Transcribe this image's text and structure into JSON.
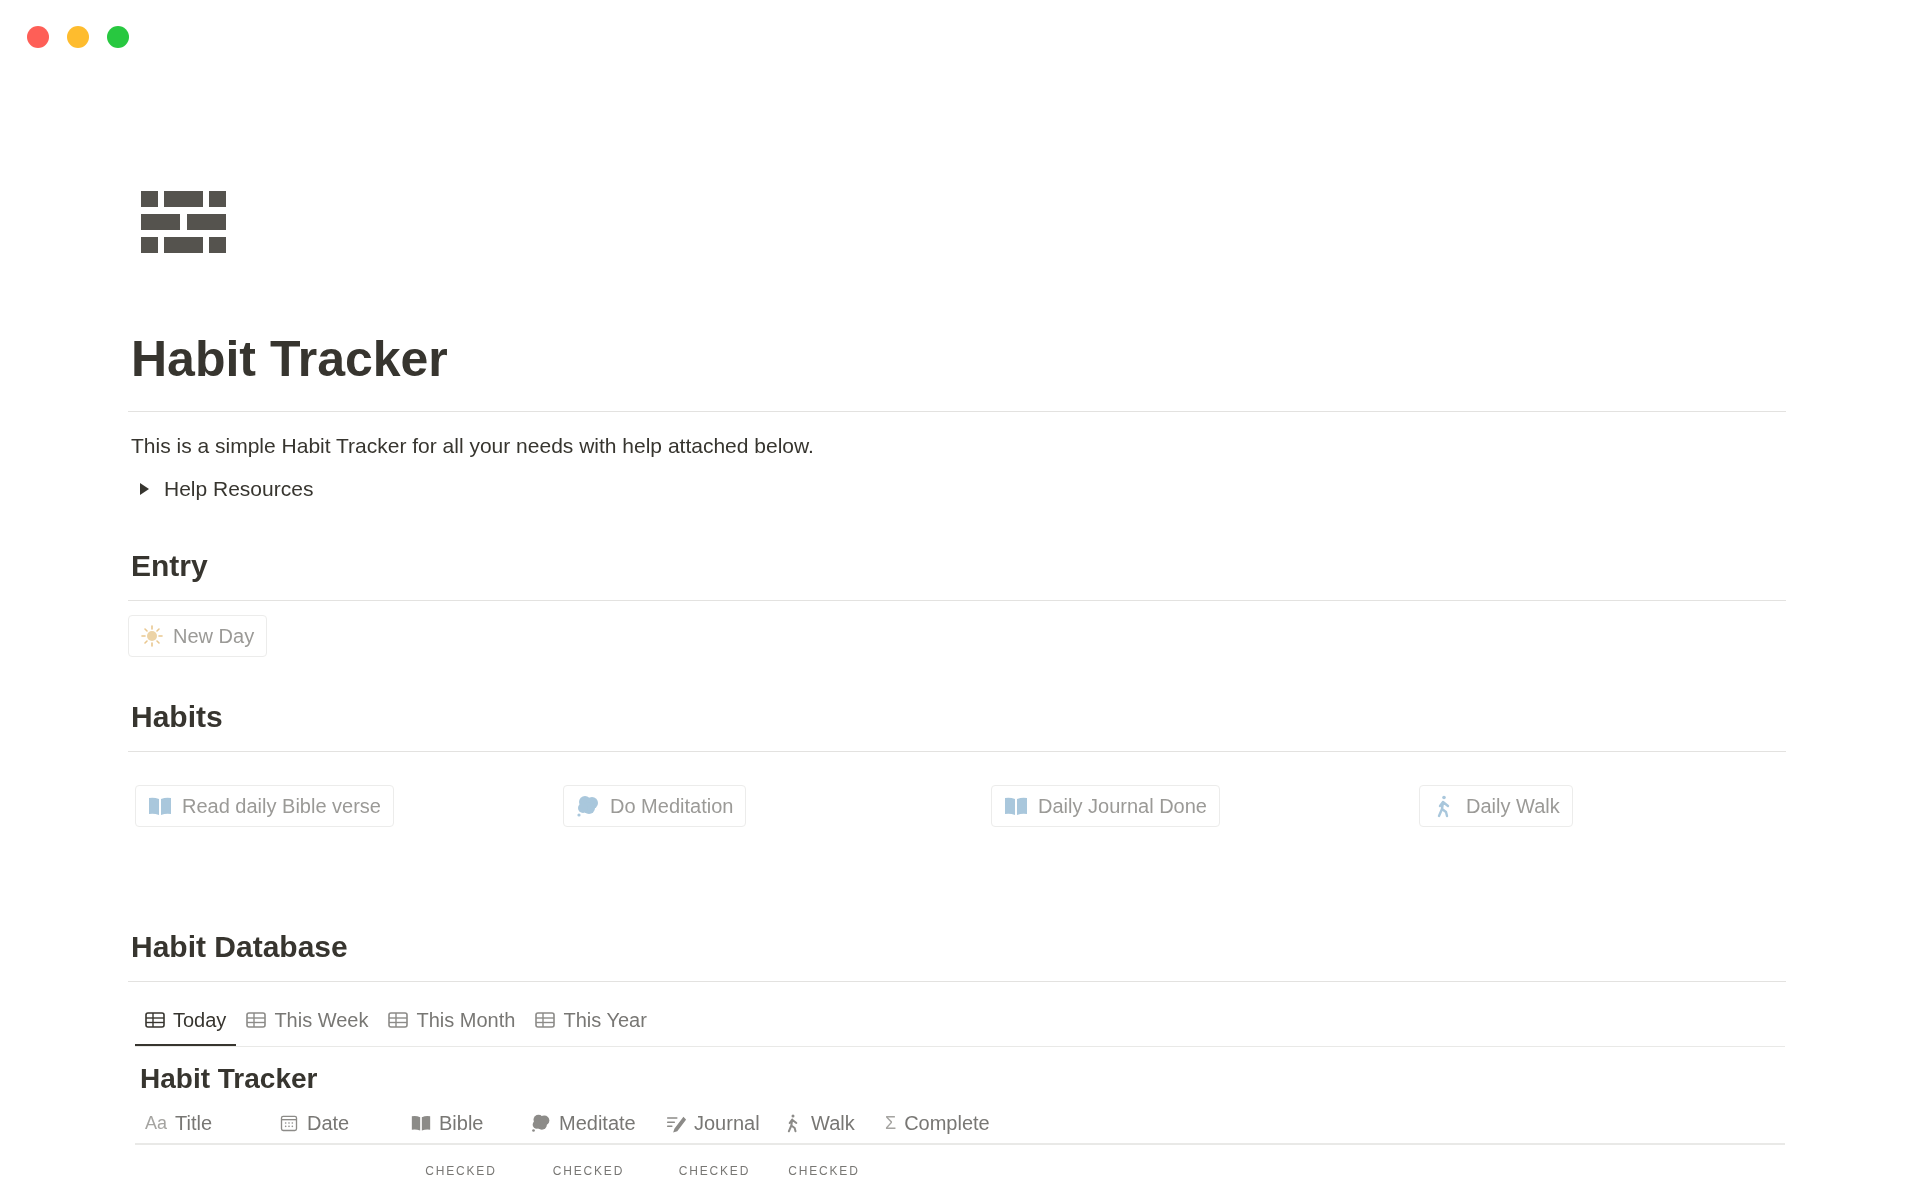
{
  "page_title": "Habit Tracker",
  "description": "This is a simple Habit Tracker for all your needs with help attached below.",
  "toggle": {
    "label": "Help Resources",
    "expanded": false
  },
  "entry": {
    "heading": "Entry",
    "button": {
      "label": "New Day"
    }
  },
  "habits": {
    "heading": "Habits",
    "buttons": [
      {
        "label": "Read daily Bible verse"
      },
      {
        "label": "Do Meditation"
      },
      {
        "label": "Daily Journal Done"
      },
      {
        "label": "Daily Walk"
      }
    ]
  },
  "database": {
    "heading": "Habit Database",
    "tabs": [
      {
        "label": "Today",
        "selected": true
      },
      {
        "label": "This Week",
        "selected": false
      },
      {
        "label": "This Month",
        "selected": false
      },
      {
        "label": "This Year",
        "selected": false
      }
    ],
    "view_title": "Habit Tracker",
    "columns": [
      {
        "label": "Title",
        "glyph": "Aa"
      },
      {
        "label": "Date"
      },
      {
        "label": "Bible",
        "summary": "CHECKED"
      },
      {
        "label": "Meditate",
        "summary": "CHECKED"
      },
      {
        "label": "Journal",
        "summary": "CHECKED"
      },
      {
        "label": "Walk",
        "summary": "CHECKED"
      },
      {
        "label": "Complete",
        "glyph": "Σ"
      }
    ]
  }
}
